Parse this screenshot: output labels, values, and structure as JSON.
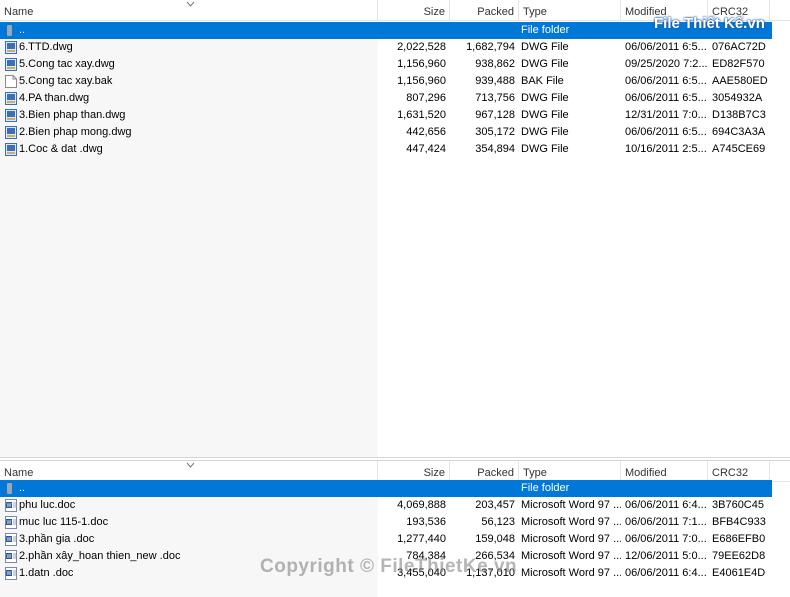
{
  "columns": {
    "name": "Name",
    "size": "Size",
    "packed": "Packed",
    "type": "Type",
    "modified": "Modified",
    "crc": "CRC32"
  },
  "top_pane": {
    "up_row": {
      "name": "..",
      "type": "File folder"
    },
    "files": [
      {
        "name": "6.TTD.dwg",
        "size": "2,022,528",
        "packed": "1,682,794",
        "type": "DWG File",
        "modified": "06/06/2011 6:5...",
        "crc": "076AC72D",
        "icon": "dwg-file-icon"
      },
      {
        "name": "5.Cong tac xay.dwg",
        "size": "1,156,960",
        "packed": "938,862",
        "type": "DWG File",
        "modified": "09/25/2020 7:2...",
        "crc": "ED82F570",
        "icon": "dwg-file-icon"
      },
      {
        "name": "5.Cong tac xay.bak",
        "size": "1,156,960",
        "packed": "939,488",
        "type": "BAK File",
        "modified": "06/06/2011 6:5...",
        "crc": "AAE580ED",
        "icon": "blank-file-icon"
      },
      {
        "name": "4.PA than.dwg",
        "size": "807,296",
        "packed": "713,756",
        "type": "DWG File",
        "modified": "06/06/2011 6:5...",
        "crc": "3054932A",
        "icon": "dwg-file-icon"
      },
      {
        "name": "3.Bien phap than.dwg",
        "size": "1,631,520",
        "packed": "967,128",
        "type": "DWG File",
        "modified": "12/31/2011 7:0...",
        "crc": "D138B7C3",
        "icon": "dwg-file-icon"
      },
      {
        "name": "2.Bien phap mong.dwg",
        "size": "442,656",
        "packed": "305,172",
        "type": "DWG File",
        "modified": "06/06/2011 6:5...",
        "crc": "694C3A3A",
        "icon": "dwg-file-icon"
      },
      {
        "name": "1.Coc & dat .dwg",
        "size": "447,424",
        "packed": "354,894",
        "type": "DWG File",
        "modified": "10/16/2011 2:5...",
        "crc": "A745CE69",
        "icon": "dwg-file-icon"
      }
    ]
  },
  "bottom_pane": {
    "up_row": {
      "name": "..",
      "type": "File folder"
    },
    "files": [
      {
        "name": "phu luc.doc",
        "size": "4,069,888",
        "packed": "203,457",
        "type": "Microsoft Word 97 ...",
        "modified": "06/06/2011 6:4...",
        "crc": "3B760C45",
        "icon": "word-doc-icon"
      },
      {
        "name": "muc luc 115-1.doc",
        "size": "193,536",
        "packed": "56,123",
        "type": "Microsoft Word 97 ...",
        "modified": "06/06/2011 7:1...",
        "crc": "BFB4C933",
        "icon": "word-doc-icon"
      },
      {
        "name": "3.phần gia .doc",
        "size": "1,277,440",
        "packed": "159,048",
        "type": "Microsoft Word 97 ...",
        "modified": "06/06/2011 7:0...",
        "crc": "E686EFB0",
        "icon": "word-doc-icon"
      },
      {
        "name": "2.phần xây_hoan thien_new .doc",
        "size": "784,384",
        "packed": "266,534",
        "type": "Microsoft Word 97 ...",
        "modified": "12/06/2011 5:0...",
        "crc": "79EE62D8",
        "icon": "word-doc-icon"
      },
      {
        "name": "1.datn .doc",
        "size": "3,455,040",
        "packed": "1,137,010",
        "type": "Microsoft Word 97 ...",
        "modified": "06/06/2011 6:4...",
        "crc": "E4061E4D",
        "icon": "word-doc-icon"
      }
    ]
  },
  "watermark": {
    "logo_text": "File Thiết Kế.vn",
    "copyright": "Copyright © FileThietKe.vn"
  },
  "colors": {
    "selection": "#0078d7",
    "name_column_bg": "#f7f7f7",
    "dwg_icon": "#3b6fb6",
    "word_icon": "#2b579a"
  }
}
